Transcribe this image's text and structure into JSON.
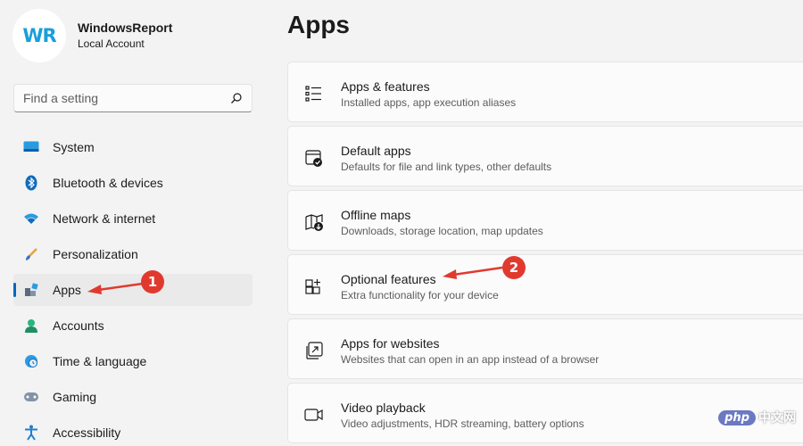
{
  "profile": {
    "avatar_text": "WR",
    "name": "WindowsReport",
    "account": "Local Account"
  },
  "search": {
    "placeholder": "Find a setting",
    "icon": "search-icon"
  },
  "sidebar": {
    "items": [
      {
        "label": "System",
        "icon": "system-display-icon"
      },
      {
        "label": "Bluetooth & devices",
        "icon": "bluetooth-icon"
      },
      {
        "label": "Network & internet",
        "icon": "wifi-icon"
      },
      {
        "label": "Personalization",
        "icon": "paintbrush-icon"
      },
      {
        "label": "Apps",
        "icon": "apps-icon",
        "active": true
      },
      {
        "label": "Accounts",
        "icon": "person-icon"
      },
      {
        "label": "Time & language",
        "icon": "globe-clock-icon"
      },
      {
        "label": "Gaming",
        "icon": "gamepad-icon"
      },
      {
        "label": "Accessibility",
        "icon": "accessibility-icon"
      }
    ]
  },
  "main": {
    "title": "Apps",
    "cards": [
      {
        "title": "Apps & features",
        "subtitle": "Installed apps, app execution aliases",
        "icon": "list-icon"
      },
      {
        "title": "Default apps",
        "subtitle": "Defaults for file and link types, other defaults",
        "icon": "default-apps-icon"
      },
      {
        "title": "Offline maps",
        "subtitle": "Downloads, storage location, map updates",
        "icon": "map-download-icon"
      },
      {
        "title": "Optional features",
        "subtitle": "Extra functionality for your device",
        "icon": "grid-plus-icon"
      },
      {
        "title": "Apps for websites",
        "subtitle": "Websites that can open in an app instead of a browser",
        "icon": "open-in-app-icon"
      },
      {
        "title": "Video playback",
        "subtitle": "Video adjustments, HDR streaming, battery options",
        "icon": "video-camera-icon"
      }
    ]
  },
  "annotations": {
    "badge1": "1",
    "badge2": "2",
    "arrow_color": "#e03a2f"
  },
  "watermark": {
    "pill": "php",
    "text": "中文网"
  },
  "colors": {
    "accent": "#0067c0",
    "background": "#f3f3f3",
    "card": "#fbfbfb"
  }
}
